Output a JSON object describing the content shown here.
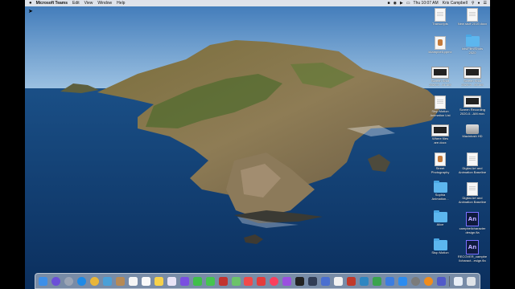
{
  "menubar": {
    "app_name": "Microsoft Teams",
    "items": [
      "Edit",
      "View",
      "Window",
      "Help"
    ],
    "clock": "Thu 10:07 AM",
    "user": "Kris Campbell",
    "status_icons": [
      "teams-icon",
      "wifi-icon",
      "volume-icon",
      "battery-icon",
      "search-icon",
      "siri-icon",
      "control-center-icon"
    ]
  },
  "desktop_icons": [
    {
      "label": "Transcripts",
      "icon": "document-icon"
    },
    {
      "label": "New stuff 2019.docx",
      "icon": "document-icon"
    },
    {
      "label": "kkampbell.ppmx",
      "icon": "image-document-icon"
    },
    {
      "label": "kris/Film/Shots\n2020",
      "icon": "folder-icon"
    },
    {
      "label": "Screen Shot\n2020-0...04 AM",
      "icon": "screenshot-icon"
    },
    {
      "label": "Screen Shot\n2020-0...05 AM",
      "icon": "screenshot-icon"
    },
    {
      "label": "Stop Motion\nAnimation List",
      "icon": "document-icon"
    },
    {
      "label": "Screen Recording\n2020-0...AM.mov",
      "icon": "screenshot-icon"
    },
    {
      "label": "Where files\nare.docx",
      "icon": "screenshot-icon"
    },
    {
      "label": "Macintosh HD",
      "icon": "hard-drive-icon"
    },
    {
      "label": "Street\nPhotography",
      "icon": "image-document-icon"
    },
    {
      "label": "Digital Art and\nAnimation Baseline",
      "icon": "document-icon"
    },
    {
      "label": "Sophia\nAnimation...",
      "icon": "folder-icon"
    },
    {
      "label": "Digital Art and\nAnimation Baseline",
      "icon": "document-icon"
    },
    {
      "label": "Alice",
      "icon": "folder-icon"
    },
    {
      "label": "campbellcharacter\ndesign.fla",
      "icon": "animate-file-icon"
    },
    {
      "label": "Stop Motion",
      "icon": "folder-icon"
    },
    {
      "label": "RECOVER_campbe\nllcharact...esign.fla",
      "icon": "animate-file-icon"
    }
  ],
  "animate_badge": "An",
  "dock": {
    "apps": [
      {
        "name": "finder-icon",
        "color": "#3d8fe8"
      },
      {
        "name": "siri-icon",
        "color": "#6b4fd8"
      },
      {
        "name": "launchpad-icon",
        "color": "#9aa4b4"
      },
      {
        "name": "safari-icon",
        "color": "#1e8ae6"
      },
      {
        "name": "chrome-icon",
        "color": "#e8b63a"
      },
      {
        "name": "photo-browser-icon",
        "color": "#4aa0d8"
      },
      {
        "name": "contacts-icon",
        "color": "#b68a56"
      },
      {
        "name": "calendar-icon",
        "color": "#f5f5f5"
      },
      {
        "name": "reminders-icon",
        "color": "#fafafa"
      },
      {
        "name": "notes-icon",
        "color": "#f7d24a"
      },
      {
        "name": "photos-icon",
        "color": "#e9e4f7"
      },
      {
        "name": "imovie-icon",
        "color": "#7a4fe0"
      },
      {
        "name": "facetime-icon",
        "color": "#3fbf4a"
      },
      {
        "name": "messages-icon",
        "color": "#45c54f"
      },
      {
        "name": "photo-booth-icon",
        "color": "#c2332f"
      },
      {
        "name": "maps-icon",
        "color": "#6cc36a"
      },
      {
        "name": "news-icon",
        "color": "#f14a4a"
      },
      {
        "name": "do-not-enter-icon",
        "color": "#e43c3c"
      },
      {
        "name": "music-icon",
        "color": "#fa3f5e"
      },
      {
        "name": "podcasts-icon",
        "color": "#9b4fe0"
      },
      {
        "name": "tv-icon",
        "color": "#222222"
      },
      {
        "name": "davinci-icon",
        "color": "#303c55"
      },
      {
        "name": "help-icon",
        "color": "#4a6fd0"
      },
      {
        "name": "pen-icon",
        "color": "#f2f2f2"
      },
      {
        "name": "photo-editor-icon",
        "color": "#c0392b"
      },
      {
        "name": "sketchbook-icon",
        "color": "#2e86c1"
      },
      {
        "name": "spreadsheet-icon",
        "color": "#3aa44e"
      },
      {
        "name": "keynote-icon",
        "color": "#3c7de0"
      },
      {
        "name": "app-store-icon",
        "color": "#2c8cf0"
      },
      {
        "name": "system-preferences-icon",
        "color": "#7b7b7b"
      },
      {
        "name": "vlc-icon",
        "color": "#f08c1c"
      },
      {
        "name": "teams-icon",
        "color": "#5059c9"
      },
      {
        "name": "separator",
        "color": ""
      },
      {
        "name": "downloads-icon",
        "color": "#e8eef7"
      },
      {
        "name": "trash-icon",
        "color": "#dfe3e8"
      }
    ]
  }
}
